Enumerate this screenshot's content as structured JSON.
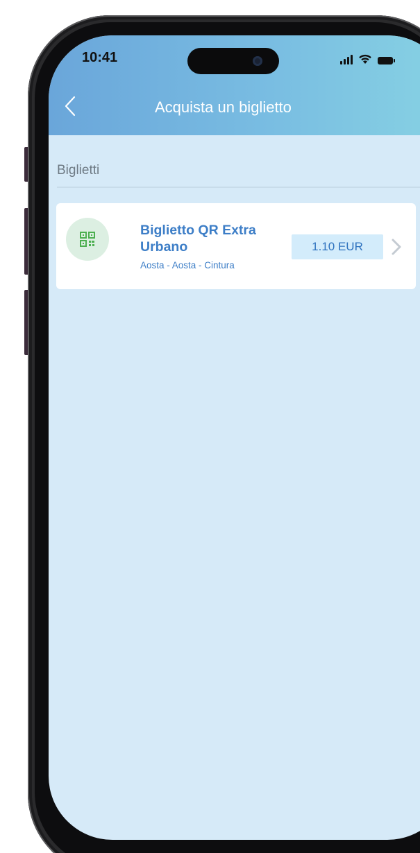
{
  "status_bar": {
    "time": "10:41",
    "signal_icon": "cellular-signal-icon",
    "wifi_icon": "wifi-icon",
    "battery_icon": "battery-icon"
  },
  "header": {
    "back_icon": "chevron-left-icon",
    "title": "Acquista un biglietto",
    "gradient_start": "#6aa6da",
    "gradient_end": "#87d2e3"
  },
  "section": {
    "title": "Biglietti"
  },
  "tickets": [
    {
      "icon": "qr-code-icon",
      "name": "Biglietto QR Extra Urbano",
      "route": "Aosta - Aosta - Cintura",
      "price": "1.10 EUR",
      "chevron_icon": "chevron-right-icon"
    }
  ],
  "colors": {
    "screen_background": "#d6eaf8",
    "accent_text": "#3d7ec7",
    "price_background": "#d3ecfb",
    "qr_icon": "#4caf50"
  }
}
